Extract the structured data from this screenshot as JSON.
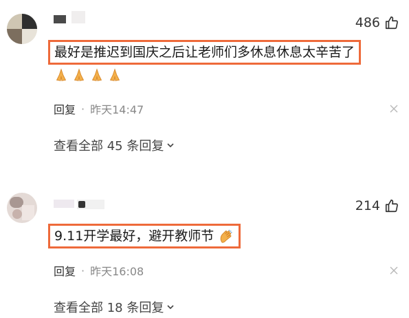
{
  "comments": [
    {
      "likes": "486",
      "text": "最好是推迟到国庆之后让老师们多休息休息太辛苦了",
      "emoji": [
        "pray",
        "pray",
        "pray",
        "pray"
      ],
      "reply_label": "回复",
      "separator": "·",
      "time": "昨天14:47",
      "expand_label": "查看全部 45 条回复"
    },
    {
      "likes": "214",
      "text": "9.11开学最好，避开教师节",
      "emoji": [
        "clap"
      ],
      "reply_label": "回复",
      "separator": "·",
      "time": "昨天16:08",
      "expand_label": "查看全部 18 条回复"
    }
  ],
  "colors": {
    "highlight_border": "#ee6a3a",
    "text": "#1a1a1a",
    "meta": "#888888"
  }
}
